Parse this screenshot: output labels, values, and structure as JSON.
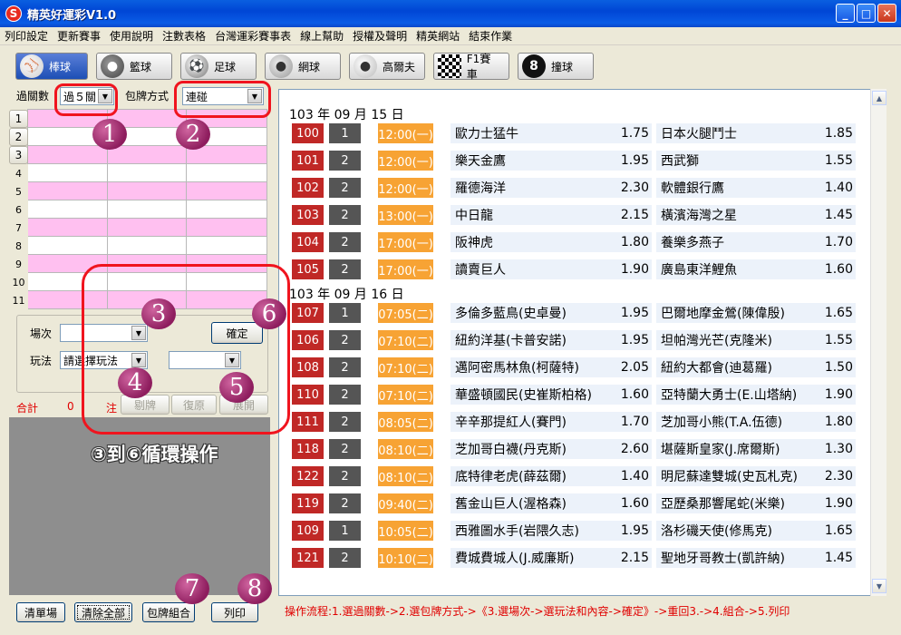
{
  "window": {
    "title": "精英好運彩V1.0",
    "icon_letter": "S",
    "controls": {
      "minimize": "_",
      "maximize": "□",
      "close": "✕"
    }
  },
  "menu": [
    "列印設定",
    "更新賽事",
    "使用說明",
    "注數表格",
    "台灣運彩賽事表",
    "線上幫助",
    "授權及聲明",
    "精英網站",
    "結束作業"
  ],
  "sports": [
    {
      "label": "棒球",
      "icon": "baseball-icon",
      "active": true
    },
    {
      "label": "籃球",
      "icon": "basketball-icon",
      "active": false
    },
    {
      "label": "足球",
      "icon": "soccer-icon",
      "active": false
    },
    {
      "label": "網球",
      "icon": "tennis-icon",
      "active": false
    },
    {
      "label": "高爾夫",
      "icon": "golf-icon",
      "active": false
    },
    {
      "label": "F1賽車",
      "icon": "checkered-flag-icon",
      "active": false
    },
    {
      "label": "撞球",
      "icon": "eight-ball-icon",
      "active": false
    }
  ],
  "left": {
    "passes_label": "過關數",
    "passes_value": "過５關",
    "method_label": "包牌方式",
    "method_value": "連碰",
    "rows": [
      "1",
      "2",
      "3",
      "4",
      "5",
      "6",
      "7",
      "8",
      "9",
      "10",
      "11"
    ],
    "session_label": "場次",
    "session_value": "",
    "play_label": "玩法",
    "play_value": "請選擇玩法",
    "play_content_value": "",
    "confirm_label": "確定",
    "total_label": "合計",
    "total_value": "0",
    "total_unit": "注",
    "remove_label": "剔牌",
    "restore_label": "復原",
    "expand_label": "展開",
    "loop_text": "③到⑥循環操作"
  },
  "bottom": {
    "clear_session": "清單場",
    "clear_all": "清除全部",
    "combine": "包牌組合",
    "print": "列印",
    "flow": "操作流程:1.選過關數->2.選包牌方式->《3.選場次->選玩法和內容->確定》->重回3.->4.組合->5.列印"
  },
  "annotations": [
    "1",
    "2",
    "3",
    "4",
    "5",
    "6",
    "7",
    "8"
  ],
  "days": [
    {
      "date": "103 年 09 月 15 日",
      "games": [
        {
          "id": "100",
          "n": "1",
          "time": "12:00(一)",
          "team_a": "歐力士猛牛",
          "odds_a": "1.75",
          "team_b": "日本火腿鬥士",
          "odds_b": "1.85"
        },
        {
          "id": "101",
          "n": "2",
          "time": "12:00(一)",
          "team_a": "樂天金鷹",
          "odds_a": "1.95",
          "team_b": "西武獅",
          "odds_b": "1.55"
        },
        {
          "id": "102",
          "n": "2",
          "time": "12:00(一)",
          "team_a": "羅德海洋",
          "odds_a": "2.30",
          "team_b": "軟體銀行鷹",
          "odds_b": "1.40"
        },
        {
          "id": "103",
          "n": "2",
          "time": "13:00(一)",
          "team_a": "中日龍",
          "odds_a": "2.15",
          "team_b": "橫濱海灣之星",
          "odds_b": "1.45"
        },
        {
          "id": "104",
          "n": "2",
          "time": "17:00(一)",
          "team_a": "阪神虎",
          "odds_a": "1.80",
          "team_b": "養樂多燕子",
          "odds_b": "1.70"
        },
        {
          "id": "105",
          "n": "2",
          "time": "17:00(一)",
          "team_a": "讀賣巨人",
          "odds_a": "1.90",
          "team_b": "廣島東洋鯉魚",
          "odds_b": "1.60"
        }
      ]
    },
    {
      "date": "103 年 09 月 16 日",
      "games": [
        {
          "id": "107",
          "n": "1",
          "time": "07:05(二)",
          "team_a": "多倫多藍鳥(史卓曼)",
          "odds_a": "1.95",
          "team_b": "巴爾地摩金鶯(陳偉殷)",
          "odds_b": "1.65"
        },
        {
          "id": "106",
          "n": "2",
          "time": "07:10(二)",
          "team_a": "紐約洋基(卡普安諾)",
          "odds_a": "1.95",
          "team_b": "坦帕灣光芒(克隆米)",
          "odds_b": "1.55"
        },
        {
          "id": "108",
          "n": "2",
          "time": "07:10(二)",
          "team_a": "邁阿密馬林魚(柯薩特)",
          "odds_a": "2.05",
          "team_b": "紐約大都會(迪葛羅)",
          "odds_b": "1.50"
        },
        {
          "id": "110",
          "n": "2",
          "time": "07:10(二)",
          "team_a": "華盛頓國民(史崔斯柏格)",
          "odds_a": "1.60",
          "team_b": "亞特蘭大勇士(E.山塔納)",
          "odds_b": "1.90"
        },
        {
          "id": "111",
          "n": "2",
          "time": "08:05(二)",
          "team_a": "辛辛那提紅人(賽門)",
          "odds_a": "1.70",
          "team_b": "芝加哥小熊(T.A.伍德)",
          "odds_b": "1.80"
        },
        {
          "id": "118",
          "n": "2",
          "time": "08:10(二)",
          "team_a": "芝加哥白襪(丹克斯)",
          "odds_a": "2.60",
          "team_b": "堪薩斯皇家(J.席爾斯)",
          "odds_b": "1.30"
        },
        {
          "id": "122",
          "n": "2",
          "time": "08:10(二)",
          "team_a": "底特律老虎(薛茲爾)",
          "odds_a": "1.40",
          "team_b": "明尼蘇達雙城(史瓦札克)",
          "odds_b": "2.30"
        },
        {
          "id": "119",
          "n": "2",
          "time": "09:40(二)",
          "team_a": "舊金山巨人(渥格森)",
          "odds_a": "1.60",
          "team_b": "亞歷桑那響尾蛇(米樂)",
          "odds_b": "1.90"
        },
        {
          "id": "109",
          "n": "1",
          "time": "10:05(二)",
          "team_a": "西雅圖水手(岩隈久志)",
          "odds_a": "1.95",
          "team_b": "洛杉磯天使(修馬克)",
          "odds_b": "1.65"
        },
        {
          "id": "121",
          "n": "2",
          "time": "10:10(二)",
          "team_a": "費城費城人(J.威廉斯)",
          "odds_a": "2.15",
          "team_b": "聖地牙哥教士(凱許納)",
          "odds_b": "1.45"
        }
      ]
    }
  ]
}
